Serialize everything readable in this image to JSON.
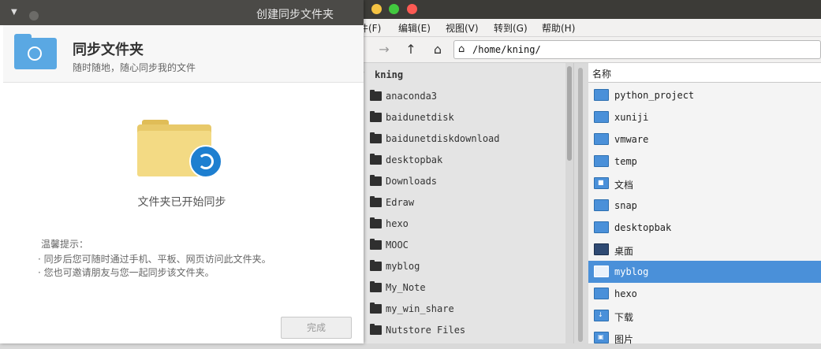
{
  "file_manager": {
    "menus": [
      "文件(F)",
      "编辑(E)",
      "视图(V)",
      "转到(G)",
      "帮助(H)"
    ],
    "path": "/home/kning/",
    "tree_root": "kning",
    "tree_items": [
      "anaconda3",
      "baidunetdisk",
      "baidunetdiskdownload",
      "desktopbak",
      "Downloads",
      "Edraw",
      "hexo",
      "MOOC",
      "myblog",
      "My_Note",
      "my_win_share",
      "Nutstore Files"
    ],
    "list_header": "名称",
    "list_items": [
      {
        "label": "python_project",
        "icon": "folder-icon"
      },
      {
        "label": "xuniji",
        "icon": "folder-icon"
      },
      {
        "label": "vmware",
        "icon": "folder-icon"
      },
      {
        "label": "temp",
        "icon": "folder-icon"
      },
      {
        "label": "文档",
        "icon": "documents-folder-icon"
      },
      {
        "label": "snap",
        "icon": "folder-icon"
      },
      {
        "label": "desktopbak",
        "icon": "folder-icon"
      },
      {
        "label": "桌面",
        "icon": "desktop-folder-icon"
      },
      {
        "label": "myblog",
        "icon": "folder-icon",
        "selected": true
      },
      {
        "label": "hexo",
        "icon": "folder-icon"
      },
      {
        "label": "下载",
        "icon": "downloads-folder-icon"
      },
      {
        "label": "图片",
        "icon": "pictures-folder-icon"
      }
    ],
    "selected_color": "#4a90d9"
  },
  "dialog": {
    "window_title": "创建同步文件夹",
    "header_title": "同步文件夹",
    "header_subtitle": "随时随地，随心同步我的文件",
    "status": "文件夹已开始同步",
    "tips_title": "温馨提示：",
    "tips": [
      "· 同步后您可随时通过手机、平板、网页访问此文件夹。",
      "· 您也可邀请朋友与您一起同步该文件夹。"
    ],
    "done_button": "完成",
    "accent_color": "#1e7fd0"
  }
}
